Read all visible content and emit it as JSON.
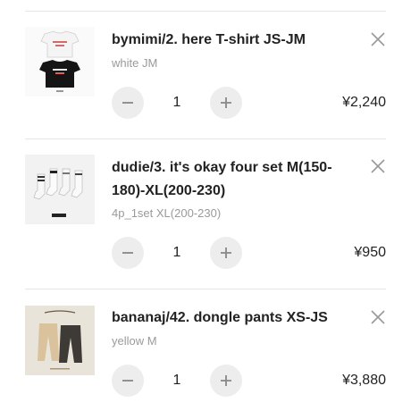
{
  "cart": {
    "items": [
      {
        "name": "bymimi/2. here T-shirt JS-JM",
        "variant": "white JM",
        "quantity": "1",
        "price": "¥2,240",
        "thumbnail_icon": "t-shirt-product-photo"
      },
      {
        "name": "dudie/3. it's okay four set M(150-180)-XL(200-230)",
        "variant": "4p_1set XL(200-230)",
        "quantity": "1",
        "price": "¥950",
        "thumbnail_icon": "socks-product-photo"
      },
      {
        "name": "bananaj/42. dongle pants XS-JS",
        "variant": "yellow M",
        "quantity": "1",
        "price": "¥3,880",
        "thumbnail_icon": "pants-product-photo"
      }
    ]
  },
  "colors": {
    "text": "#222222",
    "muted": "#9a9a9a",
    "button_bg": "#ededed",
    "divider": "#e6e6e6"
  }
}
